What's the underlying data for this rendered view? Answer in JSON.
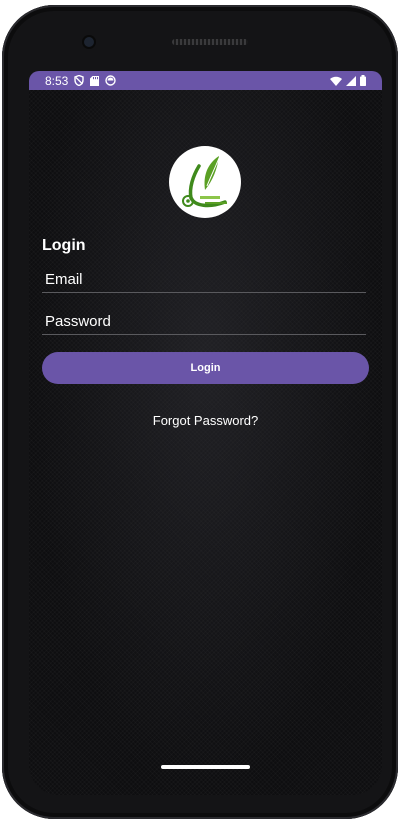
{
  "status_bar": {
    "time": "8:53",
    "left_icons": [
      "shield-icon",
      "sd-card-icon",
      "record-icon"
    ],
    "right_icons": [
      "wifi-icon",
      "cell-signal-icon",
      "battery-icon"
    ]
  },
  "logo": {
    "icon": "leaf-logo-icon"
  },
  "login": {
    "title": "Login",
    "email_placeholder": "Email",
    "email_value": "",
    "password_placeholder": "Password",
    "password_value": "",
    "button_label": "Login",
    "forgot_label": "Forgot Password?"
  },
  "colors": {
    "accent": "#6a55a8",
    "background": "#0e0e10",
    "text": "#ffffff"
  }
}
